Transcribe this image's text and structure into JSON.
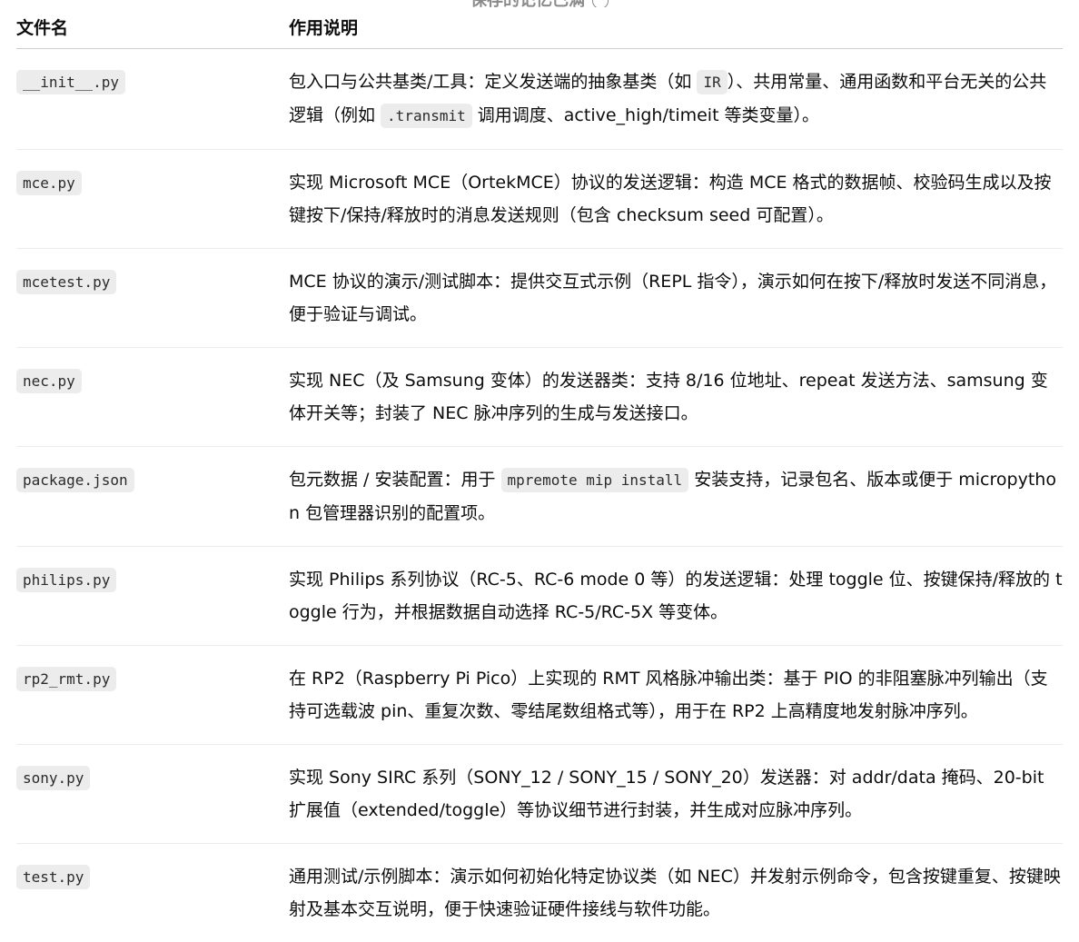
{
  "top_fade": {
    "text": "保存的记忆已满"
  },
  "table": {
    "headers": {
      "name": "文件名",
      "desc": "作用说明"
    },
    "rows": [
      {
        "file": "__init__.py",
        "desc_parts": [
          "包入口与公共基类/工具：定义发送端的抽象基类（如 ",
          "IR",
          "）、共用常量、通用函数和平台无关的公共逻辑（例如 ",
          ".transmit",
          " 调用调度、active_high/timeit 等类变量）。"
        ]
      },
      {
        "file": "mce.py",
        "desc": "实现 Microsoft MCE（OrtekMCE）协议的发送逻辑：构造 MCE 格式的数据帧、校验码生成以及按键按下/保持/释放时的消息发送规则（包含 checksum seed 可配置）。"
      },
      {
        "file": "mcetest.py",
        "desc": "MCE 协议的演示/测试脚本：提供交互式示例（REPL 指令），演示如何在按下/释放时发送不同消息，便于验证与调试。"
      },
      {
        "file": "nec.py",
        "desc": "实现 NEC（及 Samsung 变体）的发送器类：支持 8/16 位地址、repeat 发送方法、samsung 变体开关等；封装了 NEC 脉冲序列的生成与发送接口。"
      },
      {
        "file": "package.json",
        "desc_parts": [
          "包元数据 / 安装配置：用于 ",
          "mpremote mip install",
          " 安装支持，记录包名、版本或便于 micropython 包管理器识别的配置项。"
        ]
      },
      {
        "file": "philips.py",
        "desc": "实现 Philips 系列协议（RC-5、RC-6 mode 0 等）的发送逻辑：处理 toggle 位、按键保持/释放的 toggle 行为，并根据数据自动选择 RC-5/RC-5X 等变体。"
      },
      {
        "file": "rp2_rmt.py",
        "desc": "在 RP2（Raspberry Pi Pico）上实现的 RMT 风格脉冲输出类：基于 PIO 的非阻塞脉冲列输出（支持可选载波 pin、重复次数、零结尾数组格式等），用于在 RP2 上高精度地发射脉冲序列。"
      },
      {
        "file": "sony.py",
        "desc": "实现 Sony SIRC 系列（SONY_12 / SONY_15 / SONY_20）发送器：对 addr/data 掩码、20-bit 扩展值（extended/toggle）等协议细节进行封装，并生成对应脉冲序列。"
      },
      {
        "file": "test.py",
        "desc": "通用测试/示例脚本：演示如何初始化特定协议类（如 NEC）并发射示例命令，包含按键重复、按键映射及基本交互说明，便于快速验证硬件接线与软件功能。"
      }
    ]
  }
}
